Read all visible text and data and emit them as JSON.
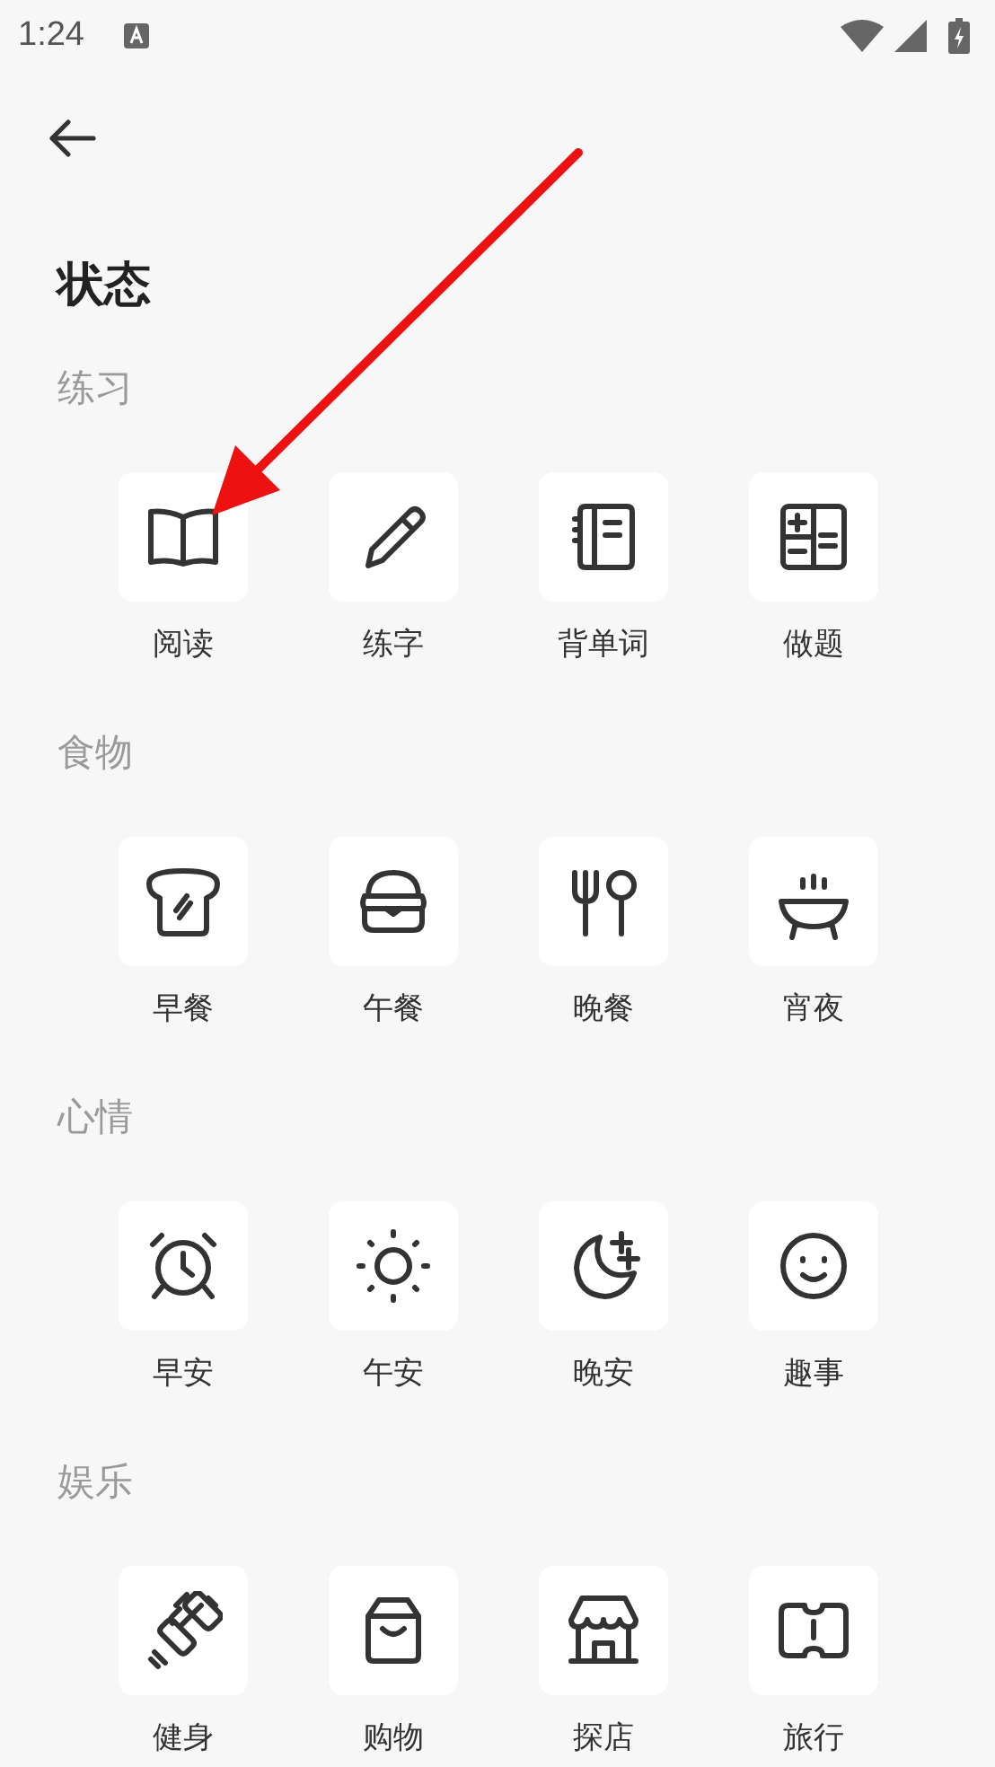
{
  "status_bar": {
    "time": "1:24"
  },
  "title": "状态",
  "sections": [
    {
      "heading": "练习",
      "items": [
        {
          "label": "阅读",
          "kind": "book"
        },
        {
          "label": "练字",
          "kind": "pencil"
        },
        {
          "label": "背单词",
          "kind": "notebook"
        },
        {
          "label": "做题",
          "kind": "calculator"
        }
      ]
    },
    {
      "heading": "食物",
      "items": [
        {
          "label": "早餐",
          "kind": "toast"
        },
        {
          "label": "午餐",
          "kind": "burger"
        },
        {
          "label": "晚餐",
          "kind": "cutlery"
        },
        {
          "label": "宵夜",
          "kind": "pot"
        }
      ]
    },
    {
      "heading": "心情",
      "items": [
        {
          "label": "早安",
          "kind": "alarm"
        },
        {
          "label": "午安",
          "kind": "sun"
        },
        {
          "label": "晚安",
          "kind": "moon"
        },
        {
          "label": "趣事",
          "kind": "smile"
        }
      ]
    },
    {
      "heading": "娱乐",
      "items": [
        {
          "label": "健身",
          "kind": "dumbbell"
        },
        {
          "label": "购物",
          "kind": "bag"
        },
        {
          "label": "探店",
          "kind": "shop"
        },
        {
          "label": "旅行",
          "kind": "ticket"
        }
      ]
    }
  ]
}
